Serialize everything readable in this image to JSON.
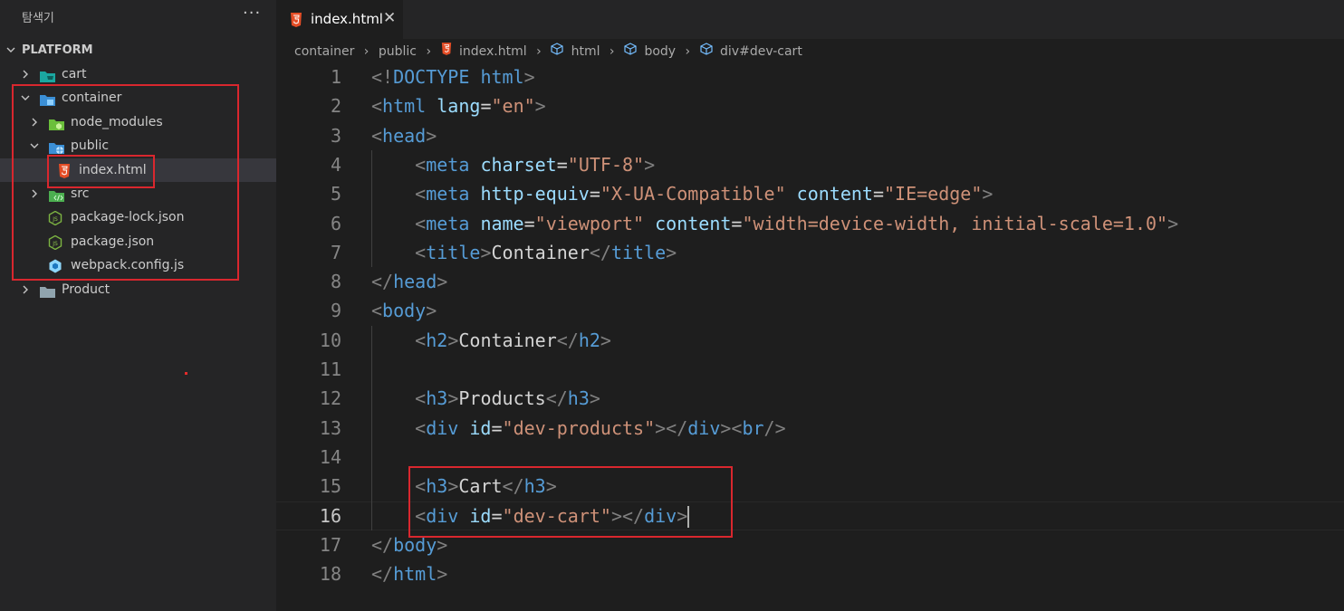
{
  "explorer": {
    "title": "탐색기",
    "more": "···",
    "root": "PLATFORM",
    "items": [
      {
        "label": "cart",
        "icon": "cart-folder-icon",
        "expanded": false
      },
      {
        "label": "container",
        "icon": "container-folder-icon",
        "expanded": true
      },
      {
        "label": "node_modules",
        "icon": "node-folder-icon",
        "expanded": false
      },
      {
        "label": "public",
        "icon": "public-folder-icon",
        "expanded": true
      },
      {
        "label": "index.html",
        "icon": "html5-icon",
        "selected": true
      },
      {
        "label": "src",
        "icon": "src-folder-icon",
        "expanded": false
      },
      {
        "label": "package-lock.json",
        "icon": "nodejs-icon"
      },
      {
        "label": "package.json",
        "icon": "nodejs-icon"
      },
      {
        "label": "webpack.config.js",
        "icon": "webpack-icon"
      },
      {
        "label": "Product",
        "icon": "folder-icon",
        "expanded": false
      }
    ]
  },
  "tab": {
    "label": "index.html",
    "close": "✕"
  },
  "breadcrumb": [
    "container",
    "public",
    "index.html",
    "html",
    "body",
    "div#dev-cart"
  ],
  "editor": {
    "current_line": 16,
    "lines": [
      {
        "n": "1",
        "tokens": [
          [
            "punc",
            "<!"
          ],
          [
            "tag",
            "DOCTYPE"
          ],
          [
            "text",
            " "
          ],
          [
            "tag",
            "html"
          ],
          [
            "punc",
            ">"
          ]
        ]
      },
      {
        "n": "2",
        "tokens": [
          [
            "punc",
            "<"
          ],
          [
            "tag",
            "html"
          ],
          [
            "text",
            " "
          ],
          [
            "attr",
            "lang"
          ],
          [
            "eq",
            "="
          ],
          [
            "str",
            "\"en\""
          ],
          [
            "punc",
            ">"
          ]
        ]
      },
      {
        "n": "3",
        "tokens": [
          [
            "punc",
            "<"
          ],
          [
            "tag",
            "head"
          ],
          [
            "punc",
            ">"
          ]
        ]
      },
      {
        "n": "4",
        "tokens": [
          [
            "text",
            "    "
          ],
          [
            "punc",
            "<"
          ],
          [
            "tag",
            "meta"
          ],
          [
            "text",
            " "
          ],
          [
            "attr",
            "charset"
          ],
          [
            "eq",
            "="
          ],
          [
            "str",
            "\"UTF-8\""
          ],
          [
            "punc",
            ">"
          ]
        ]
      },
      {
        "n": "5",
        "tokens": [
          [
            "text",
            "    "
          ],
          [
            "punc",
            "<"
          ],
          [
            "tag",
            "meta"
          ],
          [
            "text",
            " "
          ],
          [
            "attr",
            "http-equiv"
          ],
          [
            "eq",
            "="
          ],
          [
            "str",
            "\"X-UA-Compatible\""
          ],
          [
            "text",
            " "
          ],
          [
            "attr",
            "content"
          ],
          [
            "eq",
            "="
          ],
          [
            "str",
            "\"IE=edge\""
          ],
          [
            "punc",
            ">"
          ]
        ]
      },
      {
        "n": "6",
        "tokens": [
          [
            "text",
            "    "
          ],
          [
            "punc",
            "<"
          ],
          [
            "tag",
            "meta"
          ],
          [
            "text",
            " "
          ],
          [
            "attr",
            "name"
          ],
          [
            "eq",
            "="
          ],
          [
            "str",
            "\"viewport\""
          ],
          [
            "text",
            " "
          ],
          [
            "attr",
            "content"
          ],
          [
            "eq",
            "="
          ],
          [
            "str",
            "\"width=device-width, initial-scale=1.0\""
          ],
          [
            "punc",
            ">"
          ]
        ]
      },
      {
        "n": "7",
        "tokens": [
          [
            "text",
            "    "
          ],
          [
            "punc",
            "<"
          ],
          [
            "tag",
            "title"
          ],
          [
            "punc",
            ">"
          ],
          [
            "text",
            "Container"
          ],
          [
            "punc",
            "</"
          ],
          [
            "tag",
            "title"
          ],
          [
            "punc",
            ">"
          ]
        ]
      },
      {
        "n": "8",
        "tokens": [
          [
            "punc",
            "</"
          ],
          [
            "tag",
            "head"
          ],
          [
            "punc",
            ">"
          ]
        ]
      },
      {
        "n": "9",
        "tokens": [
          [
            "punc",
            "<"
          ],
          [
            "tag",
            "body"
          ],
          [
            "punc",
            ">"
          ]
        ]
      },
      {
        "n": "10",
        "tokens": [
          [
            "text",
            "    "
          ],
          [
            "punc",
            "<"
          ],
          [
            "tag",
            "h2"
          ],
          [
            "punc",
            ">"
          ],
          [
            "text",
            "Container"
          ],
          [
            "punc",
            "</"
          ],
          [
            "tag",
            "h2"
          ],
          [
            "punc",
            ">"
          ]
        ]
      },
      {
        "n": "11",
        "tokens": []
      },
      {
        "n": "12",
        "tokens": [
          [
            "text",
            "    "
          ],
          [
            "punc",
            "<"
          ],
          [
            "tag",
            "h3"
          ],
          [
            "punc",
            ">"
          ],
          [
            "text",
            "Products"
          ],
          [
            "punc",
            "</"
          ],
          [
            "tag",
            "h3"
          ],
          [
            "punc",
            ">"
          ]
        ]
      },
      {
        "n": "13",
        "tokens": [
          [
            "text",
            "    "
          ],
          [
            "punc",
            "<"
          ],
          [
            "tag",
            "div"
          ],
          [
            "text",
            " "
          ],
          [
            "attr",
            "id"
          ],
          [
            "eq",
            "="
          ],
          [
            "str",
            "\"dev-products\""
          ],
          [
            "punc",
            "></"
          ],
          [
            "tag",
            "div"
          ],
          [
            "punc",
            "><"
          ],
          [
            "tag",
            "br"
          ],
          [
            "punc",
            "/>"
          ]
        ]
      },
      {
        "n": "14",
        "tokens": []
      },
      {
        "n": "15",
        "tokens": [
          [
            "text",
            "    "
          ],
          [
            "punc",
            "<"
          ],
          [
            "tag",
            "h3"
          ],
          [
            "punc",
            ">"
          ],
          [
            "text",
            "Cart"
          ],
          [
            "punc",
            "</"
          ],
          [
            "tag",
            "h3"
          ],
          [
            "punc",
            ">"
          ]
        ]
      },
      {
        "n": "16",
        "tokens": [
          [
            "text",
            "    "
          ],
          [
            "punc",
            "<"
          ],
          [
            "tag",
            "div"
          ],
          [
            "text",
            " "
          ],
          [
            "attr",
            "id"
          ],
          [
            "eq",
            "="
          ],
          [
            "str",
            "\"dev-cart\""
          ],
          [
            "punc",
            "></"
          ],
          [
            "tag",
            "div"
          ],
          [
            "punc",
            ">"
          ]
        ]
      },
      {
        "n": "17",
        "tokens": [
          [
            "punc",
            "</"
          ],
          [
            "tag",
            "body"
          ],
          [
            "punc",
            ">"
          ]
        ]
      },
      {
        "n": "18",
        "tokens": [
          [
            "punc",
            "</"
          ],
          [
            "tag",
            "html"
          ],
          [
            "punc",
            ">"
          ]
        ]
      }
    ]
  },
  "colors": {
    "annotation_red": "#d9272e",
    "editor_bg": "#1e1e1e",
    "sidebar_bg": "#252526"
  }
}
